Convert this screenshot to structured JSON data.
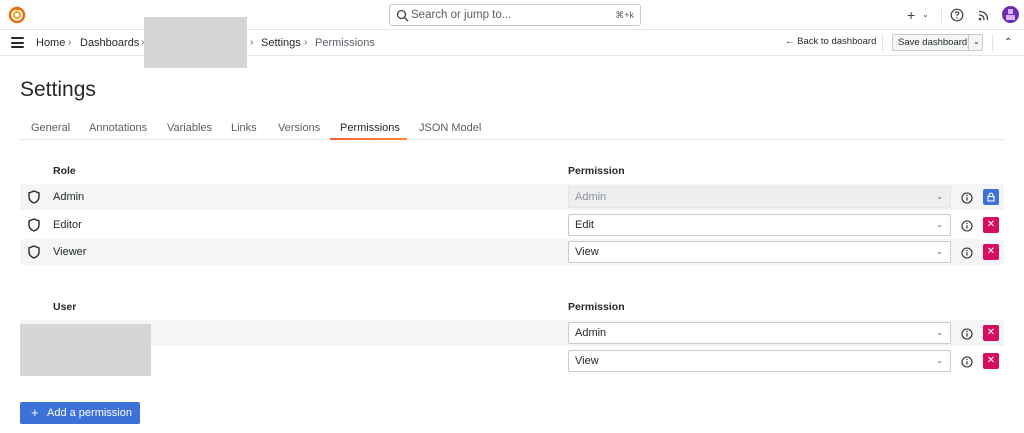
{
  "topbar": {
    "search_placeholder": "Search or jump to...",
    "search_shortcut": "⌘+k",
    "new_label": "+"
  },
  "breadcrumb": {
    "home": "Home",
    "dashboards": "Dashboards",
    "settings": "Settings",
    "permissions": "Permissions"
  },
  "actions": {
    "back_label": "Back to dashboard",
    "save_label": "Save dashboard"
  },
  "page": {
    "title": "Settings",
    "tabs": [
      "General",
      "Annotations",
      "Variables",
      "Links",
      "Versions",
      "Permissions",
      "JSON Model"
    ],
    "active_tab": "Permissions"
  },
  "roles": {
    "header_role": "Role",
    "header_permission": "Permission",
    "rows": [
      {
        "name": "Admin",
        "permission": "Admin",
        "locked": true
      },
      {
        "name": "Editor",
        "permission": "Edit",
        "locked": false
      },
      {
        "name": "Viewer",
        "permission": "View",
        "locked": false
      }
    ]
  },
  "users": {
    "header_user": "User",
    "header_permission": "Permission",
    "rows": [
      {
        "permission": "Admin"
      },
      {
        "permission": "View"
      }
    ]
  },
  "add_label": "Add a permission",
  "colors": {
    "primary": "#3d71d9",
    "danger": "#d70e5f",
    "tab_underline": "#f55f3e"
  }
}
